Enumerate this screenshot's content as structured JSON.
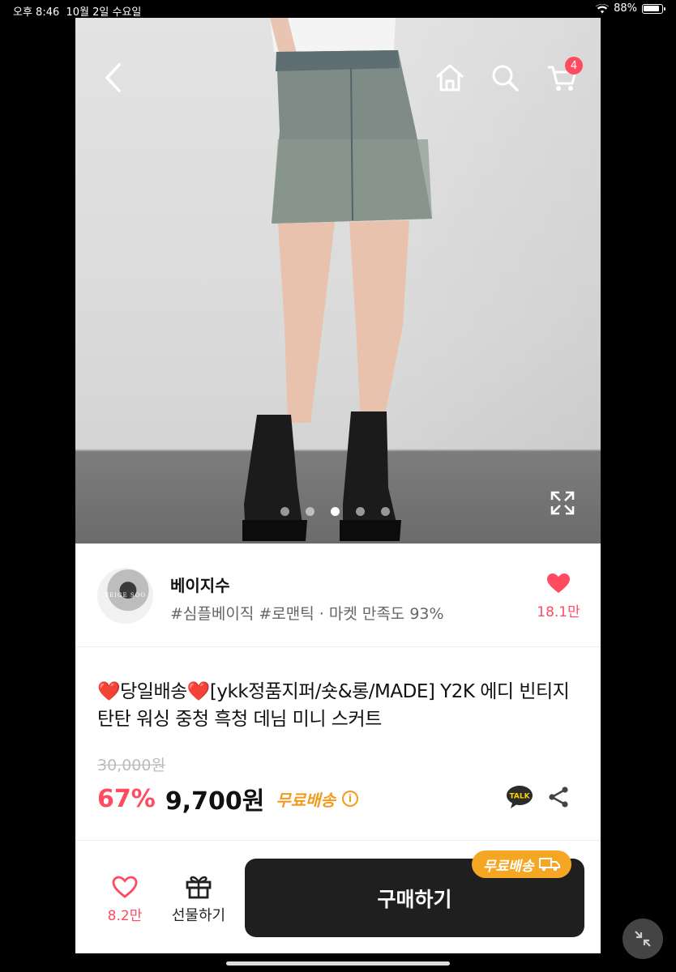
{
  "status_bar": {
    "time": "오후 8:46",
    "date": "10월 2일 수요일",
    "battery": "88%"
  },
  "header": {
    "cart_count": "4"
  },
  "carousel": {
    "total": 5,
    "active_index": 2
  },
  "seller": {
    "avatar_text": "BEIGE SOO",
    "name": "베이지수",
    "tags": "#심플베이직 #로맨틱 · 마켓 만족도 93%",
    "like_count": "18.1만"
  },
  "product": {
    "title_parts": [
      "❤️",
      "당일배송",
      "❤️",
      "[ykk정품지퍼/숏&롱/MADE] Y2K 에디 빈티지 탄탄 워싱 중청 흑청 데님 미니 스커트"
    ],
    "original_price": "30,000원",
    "discount": "67%",
    "price": "9,700원",
    "shipping": "무료배송",
    "talk_label": "TALK"
  },
  "bottom_bar": {
    "like_count": "8.2만",
    "gift_label": "선물하기",
    "buy_label": "구매하기",
    "buy_badge": "무료배송"
  },
  "colors": {
    "accent": "#ff4a60",
    "shipping": "#f29c1f",
    "buy_button": "#1f1f1f",
    "badge": "#f5a623"
  }
}
